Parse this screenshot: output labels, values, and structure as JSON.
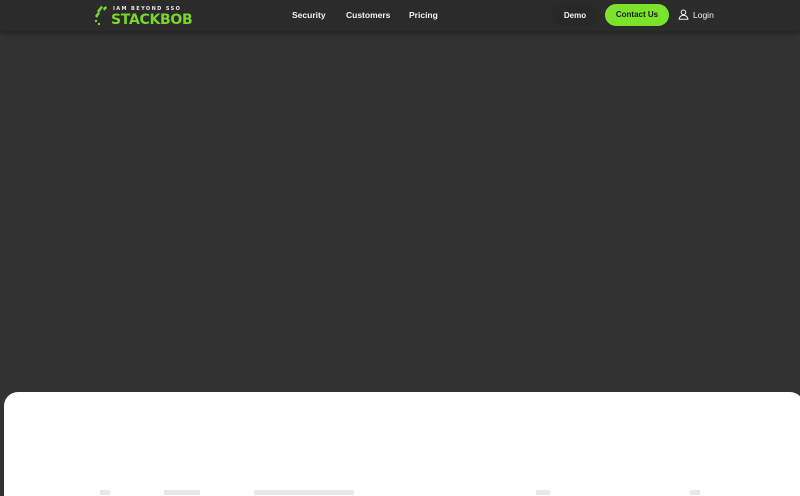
{
  "brand": {
    "tagline": "IAM BEYOND SSO",
    "name": "STACKBOB",
    "accent_color": "#7bd62a"
  },
  "nav": {
    "items": [
      {
        "label": "Security"
      },
      {
        "label": "Customers"
      },
      {
        "label": "Pricing"
      }
    ]
  },
  "actions": {
    "demo_label": "Demo",
    "contact_label": "Contact Us",
    "contact_color": "#7be32a",
    "login_label": "Login",
    "login_icon": "user-icon"
  },
  "colors": {
    "header_bg": "#2b2b2b",
    "hero_bg": "#323232",
    "panel_bg": "#ffffff"
  }
}
